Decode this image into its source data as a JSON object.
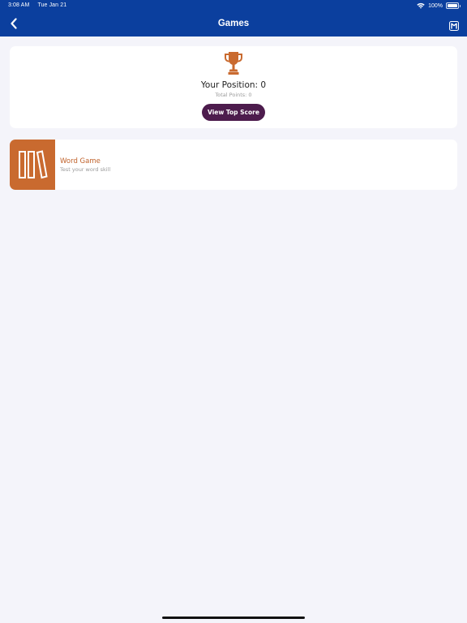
{
  "status_bar": {
    "time": "3:08 AM",
    "date": "Tue Jan 21",
    "battery": "100%"
  },
  "header": {
    "title": "Games",
    "background_color": "#0b3f9e"
  },
  "score_card": {
    "position_text": "Your Position: 0",
    "points_text": "Total Points: 0",
    "button_label": "View Top Score",
    "trophy_color": "#c96a2f",
    "button_color": "#4d1c4d"
  },
  "games": [
    {
      "title": "Word Game",
      "subtitle": "Test your word skill",
      "icon": "books-icon",
      "color": "#c96a2f"
    }
  ]
}
